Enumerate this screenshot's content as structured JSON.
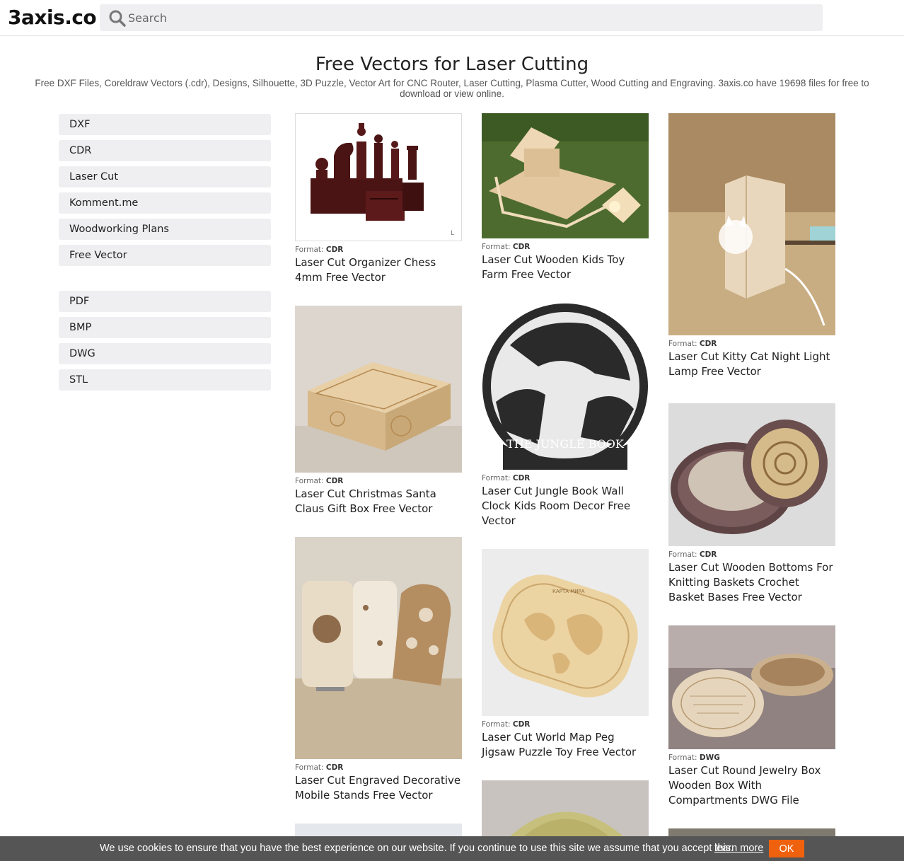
{
  "header": {
    "logo": "3axis.co",
    "search_placeholder": "Search"
  },
  "intro": {
    "title": "Free Vectors for Laser Cutting",
    "description": "Free DXF Files, Coreldraw Vectors (.cdr), Designs, Silhouette, 3D Puzzle, Vector Art for CNC Router, Laser Cutting, Plasma Cutter, Wood Cutting and Engraving. 3axis.co have 19698 files for free to download or view online."
  },
  "sidebar": {
    "group1": [
      "DXF",
      "CDR",
      "Laser Cut",
      "Komment.me",
      "Woodworking Plans",
      "Free Vector"
    ],
    "group2": [
      "PDF",
      "BMP",
      "DWG",
      "STL"
    ]
  },
  "format_label": "Format:",
  "cards": [
    {
      "format": "CDR",
      "title": "Laser Cut Organizer Chess 4mm Free Vector",
      "image": "chess-organizer-image"
    },
    {
      "format": "CDR",
      "title": "Laser Cut Wooden Kids Toy Farm Free Vector",
      "image": "toy-farm-image"
    },
    {
      "format": "CDR",
      "title": "Laser Cut Kitty Cat Night Light Lamp Free Vector",
      "image": "cat-lamp-image"
    },
    {
      "format": "CDR",
      "title": "Laser Cut Christmas Santa Claus Gift Box Free Vector",
      "image": "gift-box-image"
    },
    {
      "format": "CDR",
      "title": "Laser Cut Jungle Book Wall Clock Kids Room Decor Free Vector",
      "image": "jungle-book-clock-image"
    },
    {
      "format": "CDR",
      "title": "Laser Cut Wooden Bottoms For Knitting Baskets Crochet Basket Bases Free Vector",
      "image": "knitting-basket-image"
    },
    {
      "format": "CDR",
      "title": "Laser Cut Engraved Decorative Mobile Stands Free Vector",
      "image": "mobile-stands-image"
    },
    {
      "format": "CDR",
      "title": "Laser Cut World Map Peg Jigsaw Puzzle Toy Free Vector",
      "image": "world-map-puzzle-image"
    },
    {
      "format": "DWG",
      "title": "Laser Cut Round Jewelry Box Wooden Box With Compartments DWG File",
      "image": "jewelry-box-image"
    }
  ],
  "jungle_clock_caption": "THE JUNGLE BOOK",
  "world_map_caption": "КАРТА МИРА",
  "cookie": {
    "text": "We use cookies to ensure that you have the best experience on our website. If you continue to use this site we assume that you accept this.",
    "link": "learn more",
    "ok": "OK"
  },
  "colors": {
    "accent_ok": "#f0610e",
    "cookie_bg": "#555555",
    "sidebar_bg": "#efeff1"
  }
}
